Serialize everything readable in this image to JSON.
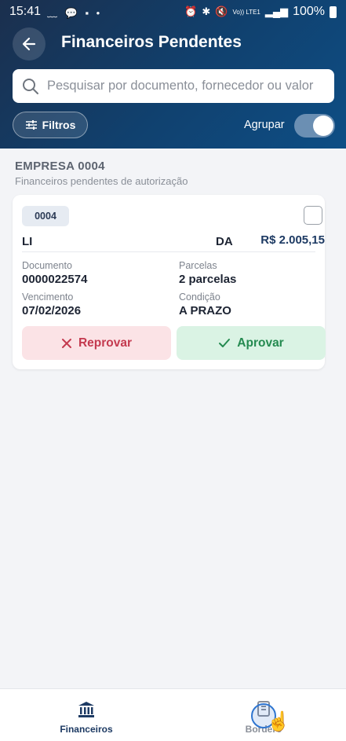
{
  "status_bar": {
    "time": "15:41",
    "network": "Vo)) LTE1",
    "battery": "100%"
  },
  "header": {
    "title": "Financeiros Pendentes"
  },
  "search": {
    "placeholder": "Pesquisar por documento, fornecedor ou valor"
  },
  "filters": {
    "button_label": "Filtros",
    "group_label": "Agrupar",
    "group_enabled": true
  },
  "section": {
    "title": "EMPRESA 0004",
    "subtitle": "Financeiros pendentes de autorização"
  },
  "card": {
    "company_code": "0004",
    "supplier_start": "LI",
    "supplier_end": "DA",
    "amount": "R$ 2.005,15",
    "fields": {
      "documento_label": "Documento",
      "documento_value": "0000022574",
      "parcelas_label": "Parcelas",
      "parcelas_value": "2 parcelas",
      "vencimento_label": "Vencimento",
      "vencimento_value": "07/02/2026",
      "condicao_label": "Condição",
      "condicao_value": "A PRAZO"
    },
    "reject_label": "Reprovar",
    "approve_label": "Aprovar"
  },
  "bottom_nav": {
    "items": [
      {
        "label": "Financeiros",
        "icon": "bank-icon",
        "active": true
      },
      {
        "label": "Borderô",
        "icon": "document-icon",
        "active": false
      }
    ]
  },
  "colors": {
    "header": "#10416f",
    "reject": "#c43a4f",
    "approve": "#248a50",
    "accent": "#1d3a63"
  }
}
